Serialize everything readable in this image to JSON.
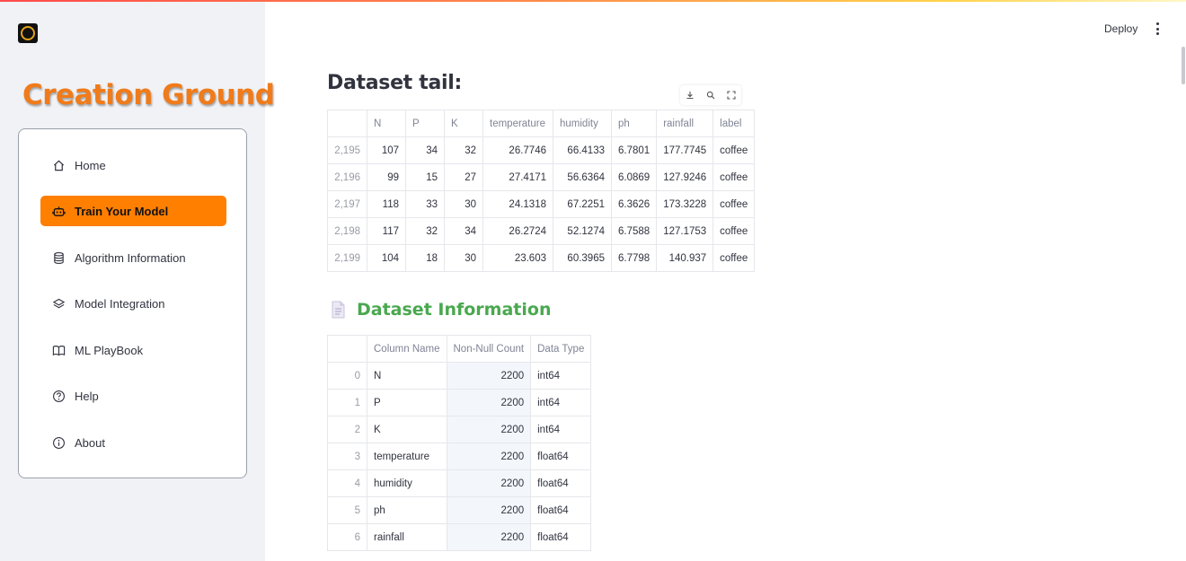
{
  "header": {
    "deploy_label": "Deploy"
  },
  "sidebar": {
    "brand": "Creation Ground",
    "items": [
      {
        "label": "Home",
        "icon": "home-icon",
        "active": false
      },
      {
        "label": "Train Your Model",
        "icon": "robot-icon",
        "active": true
      },
      {
        "label": "Algorithm Information",
        "icon": "database-icon",
        "active": false
      },
      {
        "label": "Model Integration",
        "icon": "layers-icon",
        "active": false
      },
      {
        "label": "ML PlayBook",
        "icon": "book-icon",
        "active": false
      },
      {
        "label": "Help",
        "icon": "question-circle-icon",
        "active": false
      },
      {
        "label": "About",
        "icon": "info-circle-icon",
        "active": false
      }
    ],
    "active_color": "#ff7f00"
  },
  "tail": {
    "title": "Dataset tail:",
    "columns": [
      "",
      "N",
      "P",
      "K",
      "temperature",
      "humidity",
      "ph",
      "rainfall",
      "label"
    ],
    "rows": [
      [
        "2,195",
        "107",
        "34",
        "32",
        "26.7746",
        "66.4133",
        "6.7801",
        "177.7745",
        "coffee"
      ],
      [
        "2,196",
        "99",
        "15",
        "27",
        "27.4171",
        "56.6364",
        "6.0869",
        "127.9246",
        "coffee"
      ],
      [
        "2,197",
        "118",
        "33",
        "30",
        "24.1318",
        "67.2251",
        "6.3626",
        "173.3228",
        "coffee"
      ],
      [
        "2,198",
        "117",
        "32",
        "34",
        "26.2724",
        "52.1274",
        "6.7588",
        "127.1753",
        "coffee"
      ],
      [
        "2,199",
        "104",
        "18",
        "30",
        "23.603",
        "60.3965",
        "6.7798",
        "140.937",
        "coffee"
      ]
    ]
  },
  "info": {
    "title": "Dataset Information",
    "title_color": "#4aa84f",
    "columns": [
      "",
      "Column Name",
      "Non-Null Count",
      "Data Type"
    ],
    "rows": [
      [
        "0",
        "N",
        "2200",
        "int64"
      ],
      [
        "1",
        "P",
        "2200",
        "int64"
      ],
      [
        "2",
        "K",
        "2200",
        "int64"
      ],
      [
        "3",
        "temperature",
        "2200",
        "float64"
      ],
      [
        "4",
        "humidity",
        "2200",
        "float64"
      ],
      [
        "5",
        "ph",
        "2200",
        "float64"
      ],
      [
        "6",
        "rainfall",
        "2200",
        "float64"
      ]
    ]
  }
}
